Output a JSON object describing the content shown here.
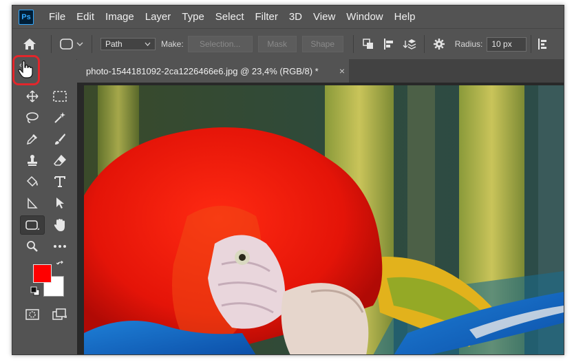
{
  "app": {
    "logo": "Ps"
  },
  "menu": [
    "File",
    "Edit",
    "Image",
    "Layer",
    "Type",
    "Select",
    "Filter",
    "3D",
    "View",
    "Window",
    "Help"
  ],
  "options": {
    "mode": "Path",
    "make_label": "Make:",
    "selection_label": "Selection...",
    "mask_label": "Mask",
    "shape_label": "Shape",
    "radius_label": "Radius:",
    "radius_value": "10 px"
  },
  "toolbox": {
    "collapse_label": "‹‹"
  },
  "document": {
    "tab_title": "photo-1544181092-2ca1226466e6.jpg @ 23,4% (RGB/8) *",
    "close_glyph": "×"
  },
  "colors": {
    "foreground": "#ff0000",
    "background": "#ffffff",
    "highlight": "#e3262b"
  }
}
